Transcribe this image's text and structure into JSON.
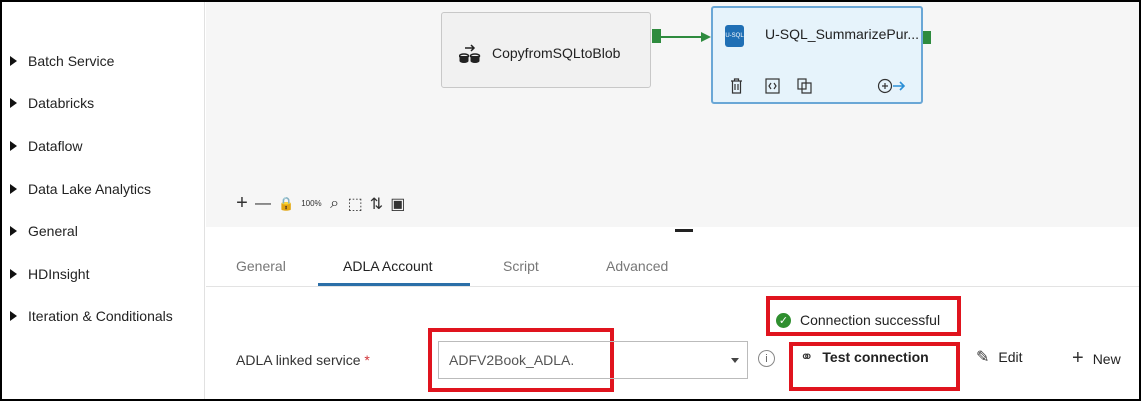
{
  "sidebar": {
    "items": [
      {
        "label": "Batch Service"
      },
      {
        "label": "Databricks"
      },
      {
        "label": "Dataflow"
      },
      {
        "label": "Data Lake Analytics"
      },
      {
        "label": "General"
      },
      {
        "label": "HDInsight"
      },
      {
        "label": "Iteration & Conditionals"
      }
    ]
  },
  "canvas": {
    "nodes": [
      {
        "label": "CopyfromSQLtoBlob",
        "icon": "copy-data-icon"
      },
      {
        "label": "U-SQL_SummarizePur...",
        "icon": "usql-icon",
        "icon_text": "U-SQL"
      }
    ],
    "toolbar": [
      "+",
      "—",
      "🔒",
      "100%",
      "⌕",
      "⬚",
      "⇅",
      "▣"
    ]
  },
  "panel": {
    "tabs": [
      {
        "label": "General",
        "active": false
      },
      {
        "label": "ADLA Account",
        "active": true
      },
      {
        "label": "Script",
        "active": false
      },
      {
        "label": "Advanced",
        "active": false
      }
    ],
    "connection_status": "Connection successful",
    "linked_service_label": "ADLA linked service",
    "required_mark": "*",
    "linked_service_value": "ADFV2Book_ADLA.",
    "test_connection_label": "Test connection",
    "edit_label": "Edit",
    "new_label": "New"
  },
  "colors": {
    "accent": "#2b6fa8",
    "success": "#2f8f2f",
    "highlight_box": "#e0141e",
    "pipeline_port": "#2e8b3e"
  }
}
